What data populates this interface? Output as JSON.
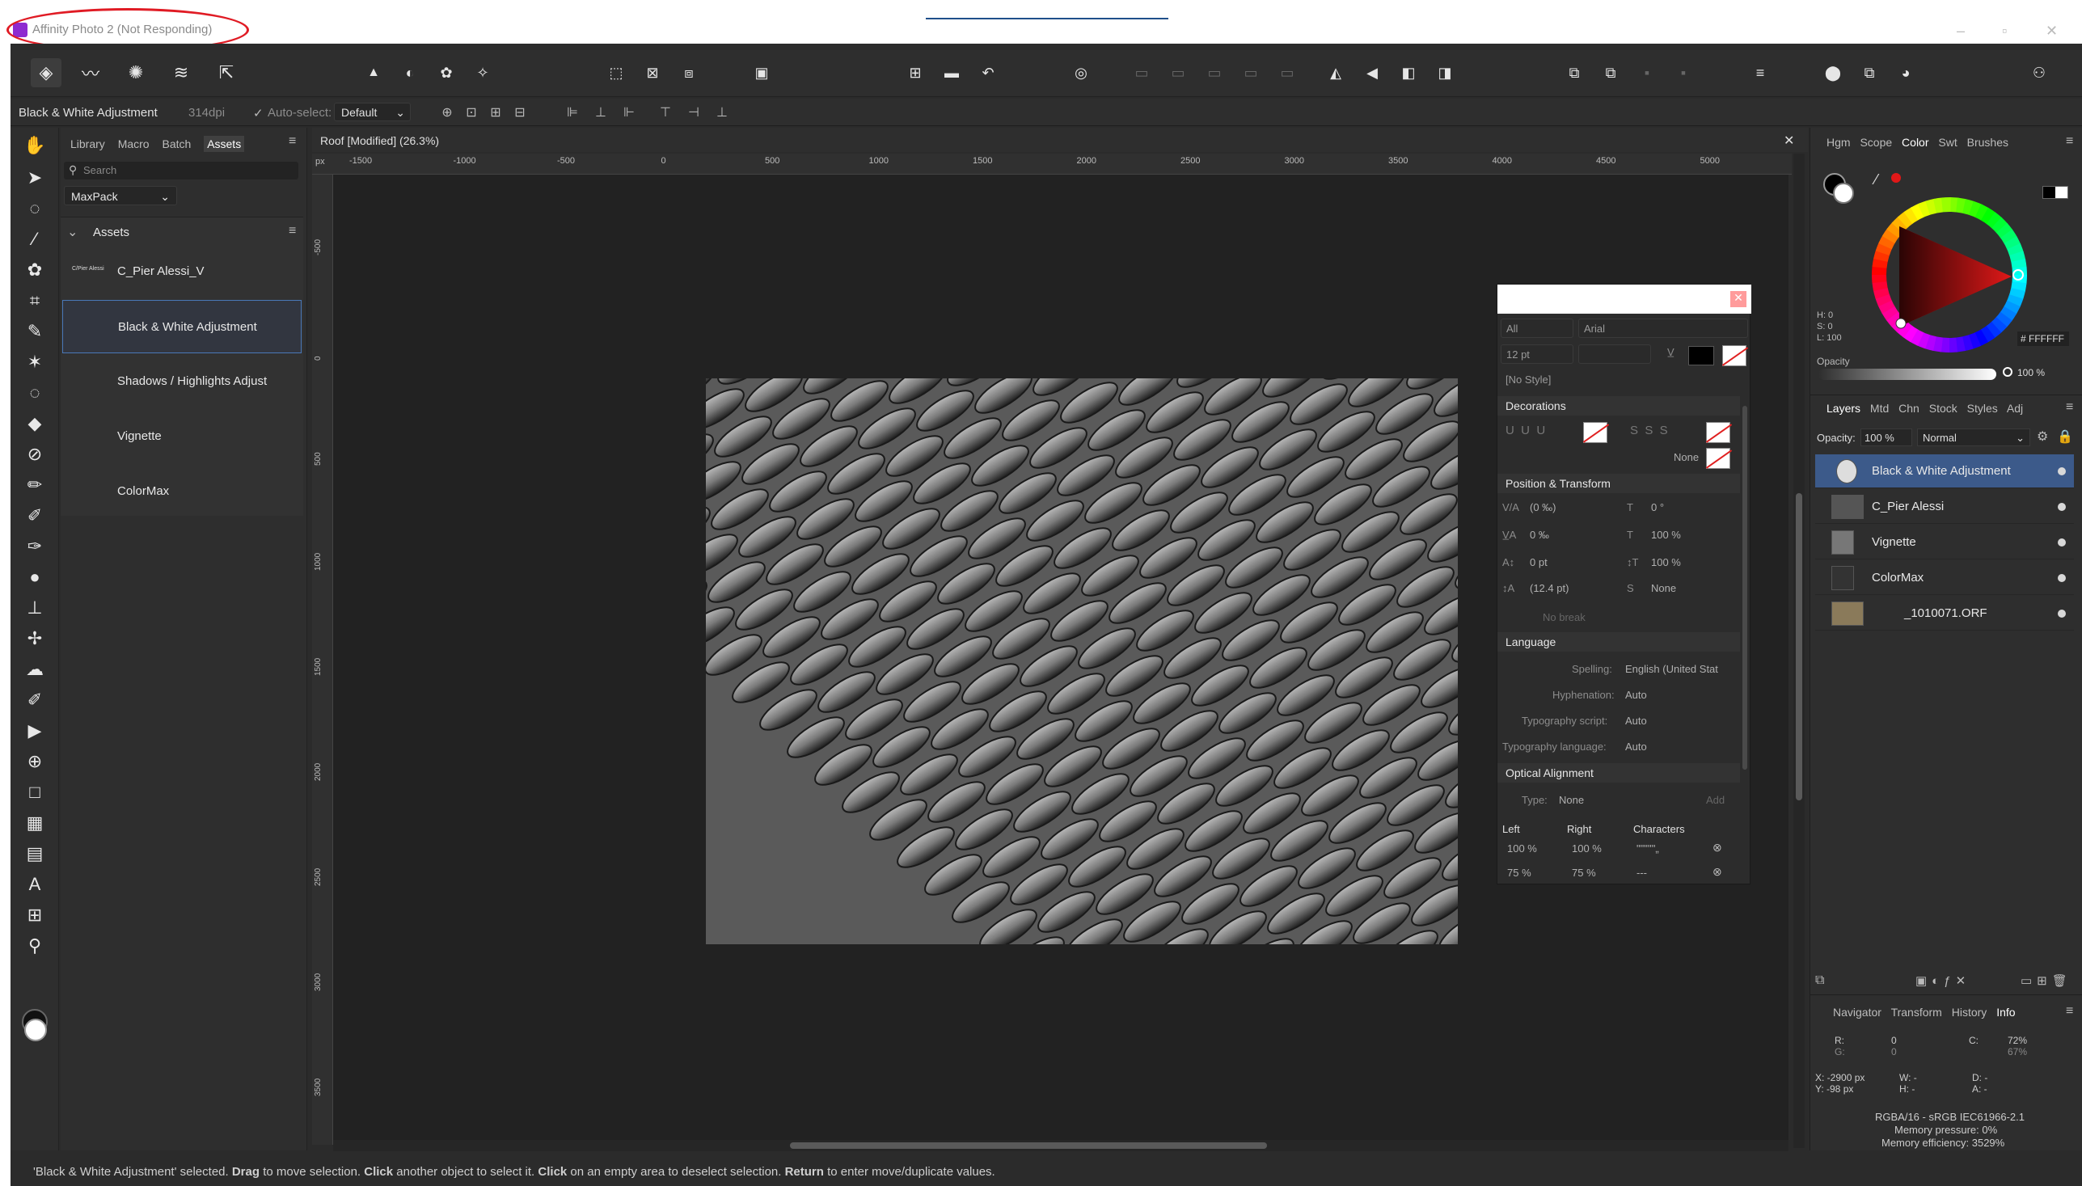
{
  "window": {
    "title": "Affinity Photo 2 (Not Responding)",
    "annotation_color": "#e01b24"
  },
  "context_toolbar": {
    "selection_name": "Black & White Adjustment",
    "dpi": "314dpi",
    "auto_select_label": "Auto-select:",
    "auto_select_value": "Default"
  },
  "left_panel": {
    "tabs": [
      "Library",
      "Macro",
      "Batch",
      "Assets"
    ],
    "active_tab": "Assets",
    "search_placeholder": "Search",
    "category": "MaxPack",
    "section_title": "Assets",
    "assets": [
      {
        "label": "C_Pier Alessi_V",
        "thumb_text": "C/Pier Alessi"
      },
      {
        "label": "Black & White Adjustment"
      },
      {
        "label": "Shadows / Highlights Adjust"
      },
      {
        "label": "Vignette"
      },
      {
        "label": "ColorMax"
      }
    ]
  },
  "document": {
    "tab_title": "Roof [Modified] (26.3%)",
    "ruler_unit": "px",
    "h_ticks": [
      "-1500",
      "-1000",
      "-500",
      "0",
      "500",
      "1000",
      "1500",
      "2000",
      "2500",
      "3000",
      "3500",
      "4000",
      "4500",
      "5000"
    ],
    "v_ticks": [
      "-500",
      "0",
      "500",
      "1000",
      "1500",
      "2000",
      "2500",
      "3000",
      "3500"
    ]
  },
  "character_panel": {
    "filter": "All",
    "font": "Arial",
    "size": "12 pt",
    "style": "[No Style]",
    "decorations_title": "Decorations",
    "decoration_none": "None",
    "position_title": "Position & Transform",
    "kerning": "(0 ‰)",
    "tracking": "0 ‰",
    "baseline": "0 pt",
    "leading": "(12.4 pt)",
    "shear": "0 °",
    "scale_h": "100 %",
    "scale_v": "100 %",
    "caps": "None",
    "no_break": "No break",
    "language_title": "Language",
    "spelling_label": "Spelling:",
    "spelling_value": "English (United Stat",
    "hyphenation_label": "Hyphenation:",
    "hyphenation_value": "Auto",
    "typography_script_label": "Typography script:",
    "typography_script_value": "Auto",
    "typography_language_label": "Typography language:",
    "typography_language_value": "Auto",
    "optical_title": "Optical Alignment",
    "type_label": "Type:",
    "type_value": "None",
    "add_label": "Add",
    "col_left": "Left",
    "col_right": "Right",
    "col_chars": "Characters",
    "row1_left": "100 %",
    "row1_right": "100 %",
    "row1_chars": "\"\"\"'\"'„",
    "row2_left": "75 %",
    "row2_right": "75 %",
    "row2_chars": "---"
  },
  "color_panel": {
    "tabs": [
      "Hgm",
      "Scope",
      "Color",
      "Swt",
      "Brushes"
    ],
    "active_tab": "Color",
    "h": "H: 0",
    "s": "S: 0",
    "l": "L: 100",
    "hex": "FFFFFF",
    "opacity_label": "Opacity",
    "opacity_value": "100 %"
  },
  "layers_panel": {
    "tabs": [
      "Layers",
      "Mtd",
      "Chn",
      "Stock",
      "Styles",
      "Adj"
    ],
    "active_tab": "Layers",
    "opacity_label": "Opacity:",
    "opacity_value": "100 %",
    "blend_mode": "Normal",
    "layers": [
      {
        "name": "Black & White Adjustment",
        "selected": true
      },
      {
        "name": "C_Pier Alessi",
        "selected": false
      },
      {
        "name": "Vignette",
        "selected": false
      },
      {
        "name": "ColorMax",
        "selected": false
      },
      {
        "name": "_1010071.ORF",
        "selected": false
      }
    ]
  },
  "info_panel": {
    "tabs": [
      "Navigator",
      "Transform",
      "History",
      "Info"
    ],
    "active_tab": "Info",
    "r_label": "R:",
    "r_value": "0",
    "g_label": "G:",
    "g_value": "0",
    "c_label": "C:",
    "c_value": "72%",
    "m_value": "67%",
    "x": "X: -2900 px",
    "y": "Y: -98 px",
    "w": "W: -",
    "h": "H: -",
    "d": "D: -",
    "a": "A: -",
    "color_profile": "RGBA/16 - sRGB IEC61966-2.1",
    "memory_pressure": "Memory pressure: 0%",
    "memory_efficiency": "Memory efficiency: 3529%"
  },
  "status": {
    "p1": "'Black & White Adjustment' selected. ",
    "b1": "Drag",
    "p2": " to move selection. ",
    "b2": "Click",
    "p3": " another object to select it. ",
    "b3": "Click",
    "p4": " on an empty area to deselect selection. ",
    "b4": "Return",
    "p5": " to enter move/duplicate values."
  }
}
